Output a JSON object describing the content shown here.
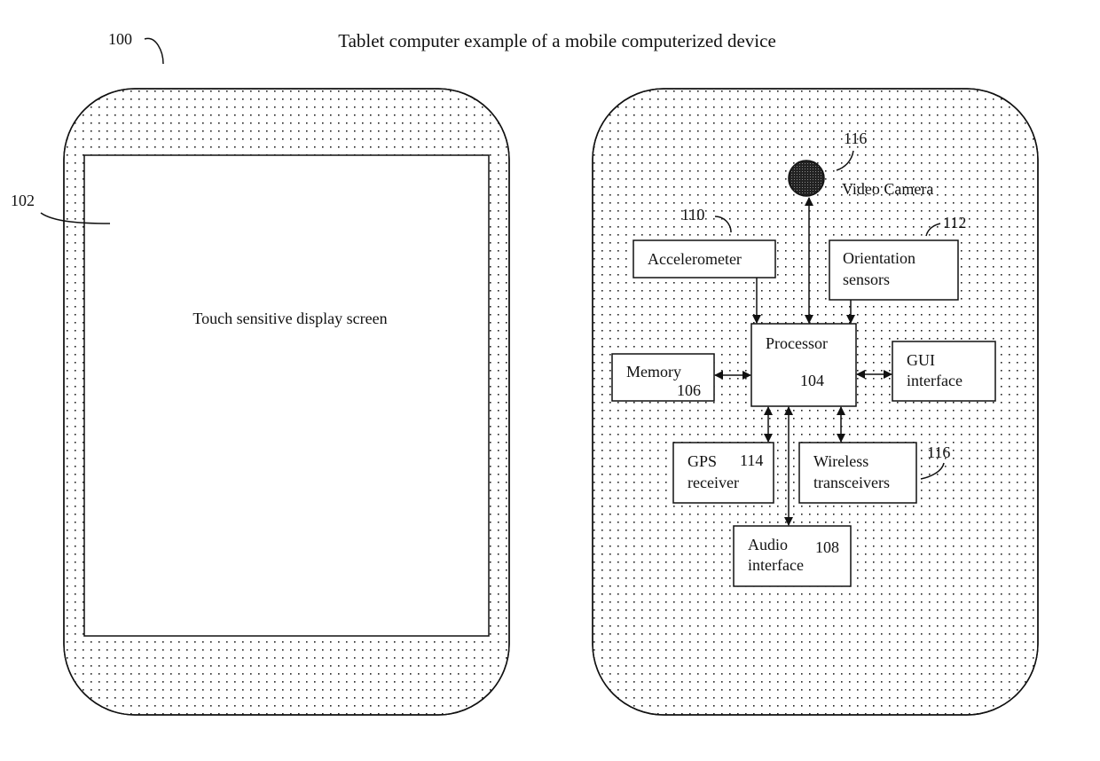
{
  "title": "Tablet computer example of a mobile computerized device",
  "refs": {
    "device": "100",
    "screen": "102"
  },
  "screen_label": "Touch sensitive display screen",
  "camera": {
    "ref": "116",
    "label": "Video Camera"
  },
  "blocks": {
    "accelerometer": {
      "lines": [
        "Accelerometer"
      ],
      "ref": "110"
    },
    "orientation": {
      "lines": [
        "Orientation",
        "sensors"
      ],
      "ref": "112"
    },
    "processor": {
      "lines": [
        "Processor"
      ],
      "ref": "104"
    },
    "memory": {
      "lines": [
        "Memory"
      ],
      "ref": "106"
    },
    "gui": {
      "lines": [
        "GUI",
        "interface"
      ]
    },
    "gps": {
      "lines": [
        "GPS",
        "receiver"
      ],
      "ref": "114"
    },
    "wireless": {
      "lines": [
        "Wireless",
        "transceivers"
      ],
      "ref": "116"
    },
    "audio": {
      "lines": [
        "Audio",
        "interface"
      ],
      "ref": "108"
    }
  }
}
